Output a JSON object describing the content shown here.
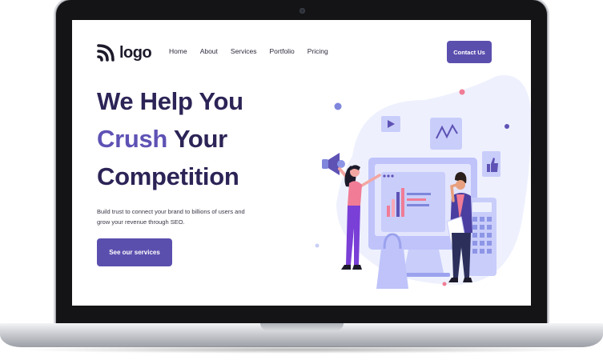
{
  "brand": {
    "logo_text": "logo"
  },
  "nav": {
    "items": [
      {
        "label": "Home"
      },
      {
        "label": "About"
      },
      {
        "label": "Services"
      },
      {
        "label": "Portfolio"
      },
      {
        "label": "Pricing"
      }
    ]
  },
  "header": {
    "contact_label": "Contact Us"
  },
  "hero": {
    "line1": "We Help You",
    "line2_accent": "Crush",
    "line2_rest": " Your",
    "line3": "Competition",
    "description": "Build trust to connect your brand to billions of users and grow your revenue through SEO.",
    "cta_label": "See our services"
  },
  "colors": {
    "primary": "#5b4fae",
    "heading": "#2c2456",
    "accent_text": "#5e52b5",
    "illustration_bg": "#eef1fd"
  },
  "icons": [
    "logo-mark-icon",
    "play-icon",
    "chart-wave-icon",
    "thumbs-up-icon",
    "megaphone-icon",
    "shopping-bag-icon",
    "calculator-icon"
  ]
}
